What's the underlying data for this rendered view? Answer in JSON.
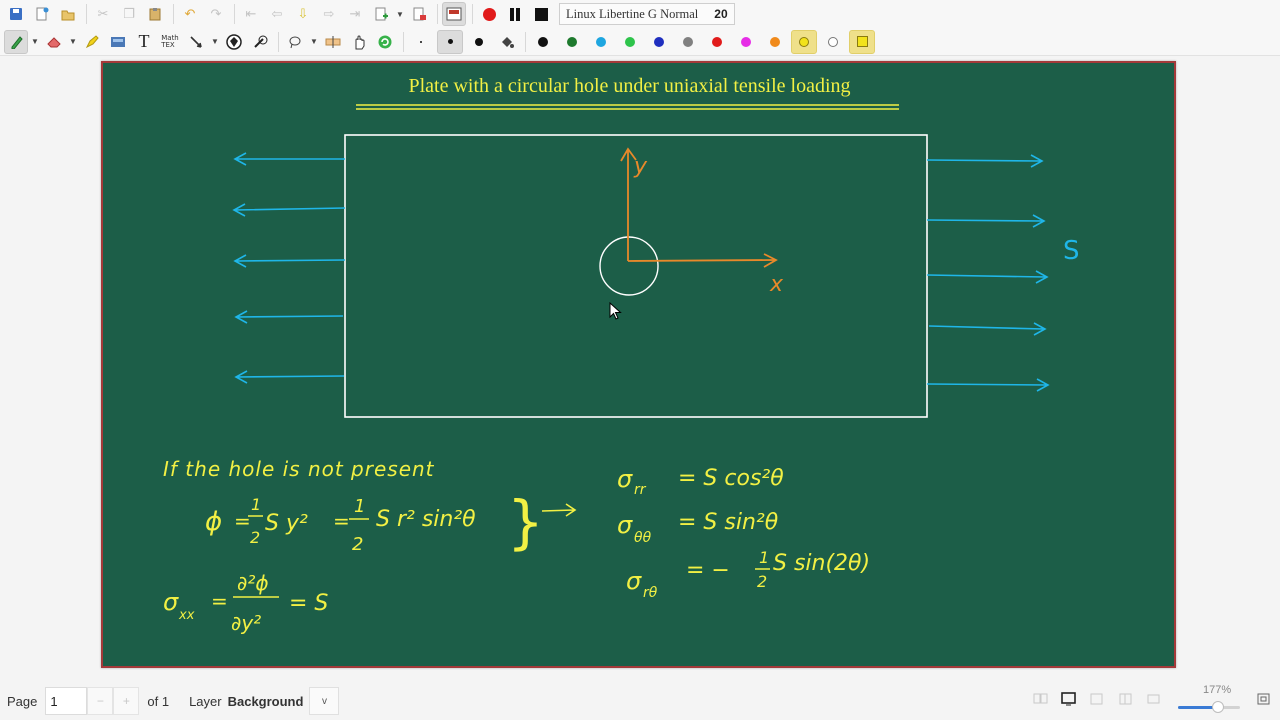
{
  "toolbar": {
    "font_name": "Linux Libertine G Normal",
    "font_size": "20",
    "pen_colors": [
      "#111111",
      "#1e7a2e",
      "#1ea6e0",
      "#2ec44b",
      "#1f2fbf",
      "#808080",
      "#e11b1b",
      "#e62de6",
      "#f08a1b",
      "#f2e21b",
      "#ffffff"
    ],
    "record_color": "#e11b1b"
  },
  "board": {
    "title": "Plate with a circular hole under uniaxial tensile loading",
    "background": "#1c5e48",
    "axis_y_label": "y",
    "axis_x_label": "x",
    "load_label": "S",
    "left_text": {
      "line1": "If the hole is not present",
      "phi_label": "ϕ",
      "eq_sign": "=",
      "half_num": "1",
      "half_den": "2",
      "phi_term1": "S y²",
      "phi_term2": "S r² sin²θ",
      "sigma_label": "σ",
      "sigma_sub": "xx",
      "deriv_num": "∂²ϕ",
      "deriv_den": "∂y²",
      "sigma_result": "= S",
      "brace": "}"
    },
    "right_text": {
      "eq1_sub": "rr",
      "eq1_rhs": "= S cos²θ",
      "eq2_sub": "θθ",
      "eq2_rhs": "= S sin²θ",
      "eq3_sub": "rθ",
      "eq3_minus": "= −",
      "eq3_num": "1",
      "eq3_den": "2",
      "eq3_rhs": "S sin(2θ)"
    },
    "colors": {
      "title": "#f2f044",
      "plate": "#ffffff",
      "axes": "#e8892a",
      "arrows": "#1fb6e8",
      "equations": "#f2f044"
    }
  },
  "status": {
    "page_label": "Page",
    "page_value": "1",
    "minus": "−",
    "plus": "+",
    "of_label": "of 1",
    "layer_label": "Layer",
    "layer_value": "Background",
    "dropdown": "v",
    "zoom": "177%",
    "zoom_fraction": 0.65
  }
}
